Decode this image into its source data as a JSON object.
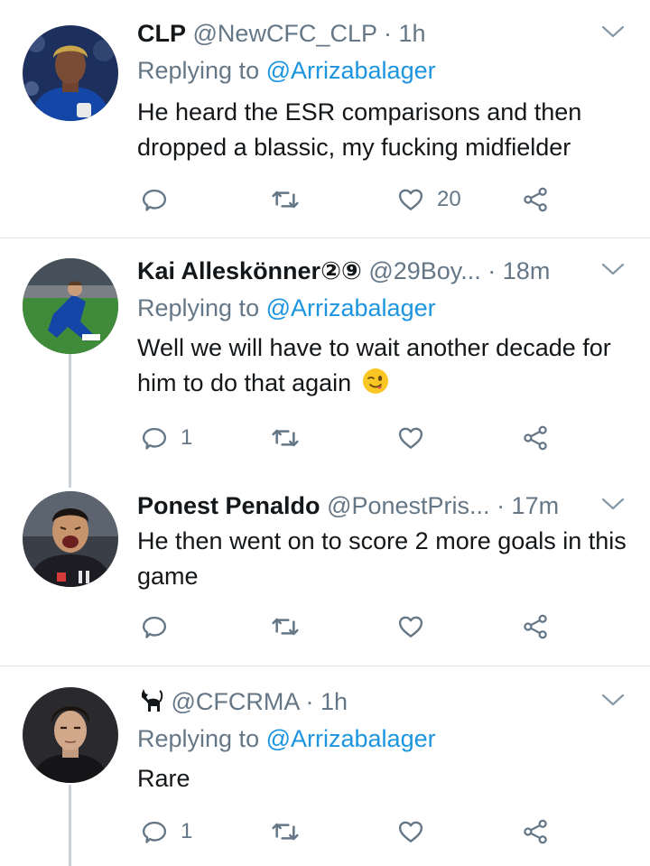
{
  "tweets": [
    {
      "name": "CLP",
      "handle": "@NewCFC_CLP",
      "time": "· 1h",
      "replying_prefix": "Replying to",
      "replying_handle": "@Arrizabalager",
      "text": "He heard the ESR comparisons and then dropped a blassic, my fucking midfielder",
      "reply_count": "",
      "retweet_count": "",
      "like_count": "20"
    },
    {
      "name": "Kai Alleskönner②⑨",
      "handle": "@29Boy...",
      "time": "· 18m",
      "replying_prefix": "Replying to",
      "replying_handle": "@Arrizabalager",
      "text": "Well we will have to wait another decade for him to do that again",
      "emoji": "winking-face-with-tongue",
      "reply_count": "1",
      "retweet_count": "",
      "like_count": ""
    },
    {
      "name": "Ponest Penaldo",
      "handle": "@PonestPris...",
      "time": "· 17m",
      "text": "He then went on to score 2 more goals in this game",
      "reply_count": "",
      "retweet_count": "",
      "like_count": ""
    },
    {
      "name": "🐈‍⬛",
      "handle": "@CFCRMA",
      "time": "· 1h",
      "replying_prefix": "Replying to",
      "replying_handle": "@Arrizabalager",
      "text": "Rare",
      "reply_count": "1",
      "retweet_count": "",
      "like_count": ""
    }
  ],
  "icons": {
    "reply": "reply-icon",
    "retweet": "retweet-icon",
    "like": "heart-icon",
    "share": "share-icon",
    "menu": "chevron-down-icon"
  },
  "colors": {
    "text": "#14171a",
    "secondary": "#657786",
    "link": "#1b95e0",
    "icon": "#657786",
    "divider": "#dde1e5",
    "thread_line": "#c9d2db"
  }
}
